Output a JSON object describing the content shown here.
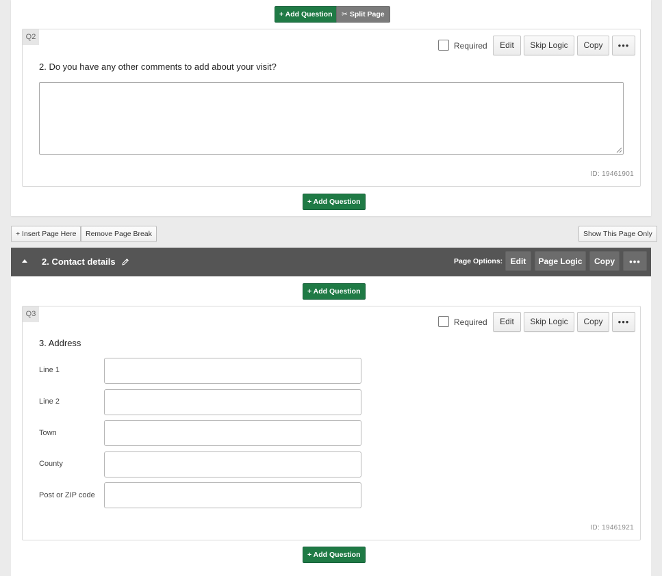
{
  "page1": {
    "top_actions": {
      "add_question": "+ Add Question",
      "split_page": "Split Page"
    },
    "question": {
      "number_badge": "Q2",
      "required_label": "Required",
      "actions": {
        "edit": "Edit",
        "skip_logic": "Skip Logic",
        "copy": "Copy",
        "more": "•••"
      },
      "title": "2. Do you have any other comments to add about your visit?",
      "id_text": "ID: 19461901"
    },
    "bottom_add_question": "+ Add Question"
  },
  "page_break_controls": {
    "insert_page_here": "+ Insert Page Here",
    "remove_page_break": "Remove Page Break",
    "show_this_page_only": "Show This Page Only"
  },
  "page2": {
    "header": {
      "title": "2. Contact details",
      "options_label": "Page Options:",
      "actions": {
        "edit": "Edit",
        "page_logic": "Page Logic",
        "copy": "Copy",
        "more": "•••"
      }
    },
    "top_add_question": "+ Add Question",
    "question": {
      "number_badge": "Q3",
      "required_label": "Required",
      "actions": {
        "edit": "Edit",
        "skip_logic": "Skip Logic",
        "copy": "Copy",
        "more": "•••"
      },
      "title": "3. Address",
      "fields": [
        {
          "label": "Line 1",
          "value": ""
        },
        {
          "label": "Line 2",
          "value": ""
        },
        {
          "label": "Town",
          "value": ""
        },
        {
          "label": "County",
          "value": ""
        },
        {
          "label": "Post or ZIP code",
          "value": ""
        }
      ],
      "id_text": "ID: 19461921"
    },
    "bottom_add_question": "+ Add Question"
  },
  "colors": {
    "accent_green": "#1f7a45",
    "page_header_bg": "#555555",
    "background": "#ebebeb"
  },
  "icons": {
    "split_page": "scissors-icon",
    "edit_page_title": "pencil-icon",
    "collapse_page": "caret-up-icon",
    "more": "ellipsis-icon"
  }
}
